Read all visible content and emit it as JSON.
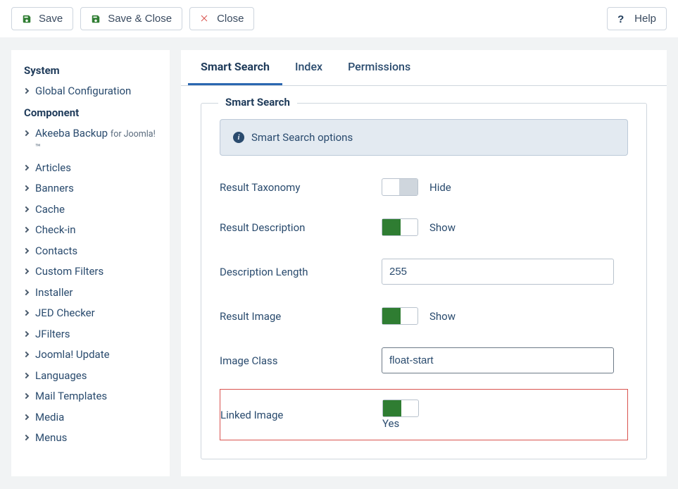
{
  "toolbar": {
    "save": "Save",
    "save_close": "Save & Close",
    "close": "Close",
    "help": "Help"
  },
  "sidebar": {
    "group_system": "System",
    "global_config": "Global Configuration",
    "group_component": "Component",
    "items": [
      {
        "label": "Akeeba Backup",
        "sub": "for Joomla!™"
      },
      {
        "label": "Articles"
      },
      {
        "label": "Banners"
      },
      {
        "label": "Cache"
      },
      {
        "label": "Check-in"
      },
      {
        "label": "Contacts"
      },
      {
        "label": "Custom Filters"
      },
      {
        "label": "Installer"
      },
      {
        "label": "JED Checker"
      },
      {
        "label": "JFilters"
      },
      {
        "label": "Joomla! Update"
      },
      {
        "label": "Languages"
      },
      {
        "label": "Mail Templates"
      },
      {
        "label": "Media"
      },
      {
        "label": "Menus"
      }
    ]
  },
  "tabs": {
    "smart_search": "Smart Search",
    "index": "Index",
    "permissions": "Permissions"
  },
  "fieldset": {
    "legend": "Smart Search",
    "notice": "Smart Search options",
    "result_taxonomy": {
      "label": "Result Taxonomy",
      "state_text": "Hide"
    },
    "result_description": {
      "label": "Result Description",
      "state_text": "Show"
    },
    "description_length": {
      "label": "Description Length",
      "value": "255"
    },
    "result_image": {
      "label": "Result Image",
      "state_text": "Show"
    },
    "image_class": {
      "label": "Image Class",
      "value": "float-start"
    },
    "linked_image": {
      "label": "Linked Image",
      "state_text": "Yes"
    }
  }
}
